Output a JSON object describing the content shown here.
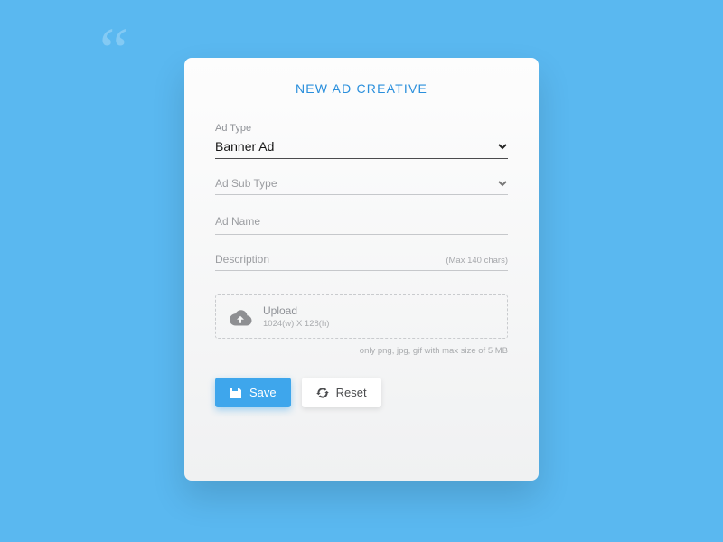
{
  "title": "NEW AD CREATIVE",
  "fields": {
    "adType": {
      "label": "Ad Type",
      "value": "Banner Ad"
    },
    "adSubType": {
      "placeholder": "Ad Sub Type"
    },
    "adName": {
      "placeholder": "Ad Name"
    },
    "description": {
      "placeholder": "Description",
      "hint": "(Max 140 chars)"
    }
  },
  "upload": {
    "label": "Upload",
    "dimensions": "1024(w) X 128(h)",
    "hint": "only png, jpg, gif with max size of 5 MB"
  },
  "buttons": {
    "save": "Save",
    "reset": "Reset"
  }
}
